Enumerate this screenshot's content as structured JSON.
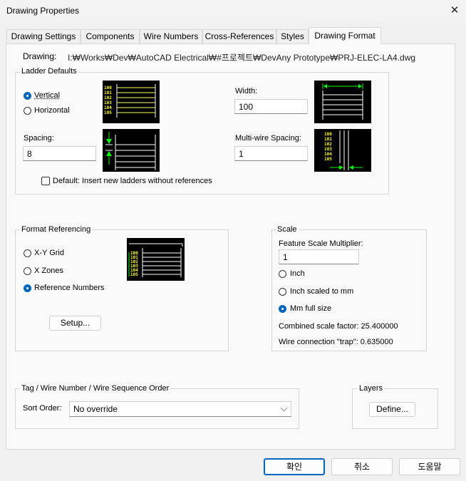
{
  "window": {
    "title": "Drawing Properties",
    "close_glyph": "✕"
  },
  "tabs": [
    {
      "label": "Drawing Settings",
      "active": false
    },
    {
      "label": "Components",
      "active": false
    },
    {
      "label": "Wire Numbers",
      "active": false
    },
    {
      "label": "Cross-References",
      "active": false
    },
    {
      "label": "Styles",
      "active": false
    },
    {
      "label": "Drawing Format",
      "active": true
    }
  ],
  "drawing": {
    "label": "Drawing:",
    "path": "I:₩Works₩Dev₩AutoCAD Electrical₩#프로젝트₩DevAny Prototype₩PRJ-ELEC-LA4.dwg"
  },
  "ladder_defaults": {
    "title": "Ladder Defaults",
    "vertical_label": "Vertical",
    "horizontal_label": "Horizontal",
    "selected": "vertical",
    "spacing_label": "Spacing:",
    "spacing_value": "8",
    "width_label": "Width:",
    "width_value": "100",
    "multiwire_label": "Multi-wire Spacing:",
    "multiwire_value": "1",
    "default_checkbox_label": "Default: Insert new ladders without references",
    "default_checked": false,
    "preview_numbers": [
      "100",
      "101",
      "102",
      "103",
      "104",
      "105"
    ]
  },
  "format_referencing": {
    "title": "Format Referencing",
    "xy_grid_label": "X-Y Grid",
    "x_zones_label": "X Zones",
    "reference_numbers_label": "Reference Numbers",
    "selected": "reference_numbers",
    "setup_label": "Setup...",
    "preview_numbers": [
      "100",
      "101",
      "102",
      "103",
      "104",
      "105"
    ]
  },
  "scale": {
    "title": "Scale",
    "multiplier_label": "Feature Scale Multiplier:",
    "multiplier_value": "1",
    "inch_label": "Inch",
    "inch_mm_label": "Inch scaled to mm",
    "mm_full_label": "Mm full size",
    "selected": "mm_full",
    "combined_label": "Combined scale factor: 25.400000",
    "trap_label": "Wire connection \"trap\": 0.635000"
  },
  "sequence": {
    "title": "Tag / Wire Number / Wire Sequence Order",
    "sort_label": "Sort Order:",
    "sort_value": "No override",
    "chevron_glyph": "⌵"
  },
  "layers": {
    "title": "Layers",
    "define_label": "Define..."
  },
  "footer": {
    "ok_label": "확인",
    "cancel_label": "취소",
    "help_label": "도움말"
  },
  "colors": {
    "accent": "#0067c0",
    "preview_bg": "#000000",
    "preview_text": "#ffff00",
    "preview_arrow": "#00ff00"
  }
}
